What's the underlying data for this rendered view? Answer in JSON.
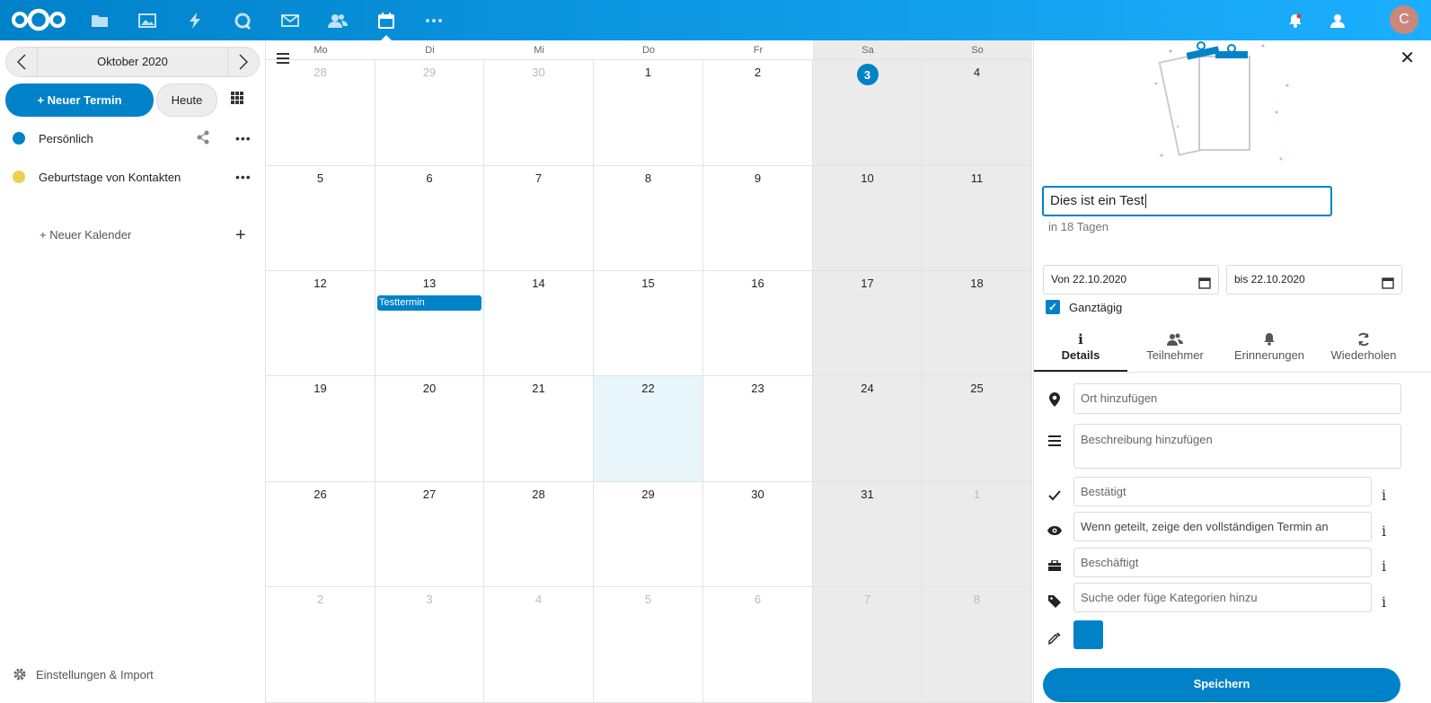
{
  "topbar": {
    "apps": [
      {
        "name": "files-icon"
      },
      {
        "name": "photos-icon"
      },
      {
        "name": "activity-icon"
      },
      {
        "name": "talk-icon"
      },
      {
        "name": "mail-icon"
      },
      {
        "name": "contacts-icon"
      },
      {
        "name": "calendar-icon"
      },
      {
        "name": "more-apps-icon"
      }
    ],
    "avatar_initial": "C",
    "brand_color": "#0082c9"
  },
  "sidebar": {
    "month_label": "Oktober 2020",
    "new_event_label": "+ Neuer Termin",
    "today_label": "Heute",
    "calendars": [
      {
        "name": "Persönlich",
        "color": "#0082c9"
      },
      {
        "name": "Geburtstage von Kontakten",
        "color": "#e9d04f"
      }
    ],
    "new_calendar_label": "+ Neuer Kalender",
    "settings_label": "Einstellungen & Import"
  },
  "calendar": {
    "weekdays": [
      "Mo",
      "Di",
      "Mi",
      "Do",
      "Fr",
      "Sa",
      "So"
    ],
    "weeks": [
      [
        {
          "d": "28",
          "other": true
        },
        {
          "d": "29",
          "other": true
        },
        {
          "d": "30",
          "other": true
        },
        {
          "d": "1"
        },
        {
          "d": "2"
        },
        {
          "d": "3",
          "today": true
        },
        {
          "d": "4"
        }
      ],
      [
        {
          "d": "5"
        },
        {
          "d": "6"
        },
        {
          "d": "7"
        },
        {
          "d": "8"
        },
        {
          "d": "9"
        },
        {
          "d": "10"
        },
        {
          "d": "11"
        }
      ],
      [
        {
          "d": "12"
        },
        {
          "d": "13"
        },
        {
          "d": "14"
        },
        {
          "d": "15"
        },
        {
          "d": "16"
        },
        {
          "d": "17"
        },
        {
          "d": "18"
        }
      ],
      [
        {
          "d": "19"
        },
        {
          "d": "20"
        },
        {
          "d": "21"
        },
        {
          "d": "22",
          "selected": true
        },
        {
          "d": "23"
        },
        {
          "d": "24"
        },
        {
          "d": "25"
        }
      ],
      [
        {
          "d": "26"
        },
        {
          "d": "27"
        },
        {
          "d": "28"
        },
        {
          "d": "29"
        },
        {
          "d": "30"
        },
        {
          "d": "31"
        },
        {
          "d": "1",
          "other": true
        }
      ],
      [
        {
          "d": "2",
          "other": true
        },
        {
          "d": "3",
          "other": true
        },
        {
          "d": "4",
          "other": true
        },
        {
          "d": "5",
          "other": true
        },
        {
          "d": "6",
          "other": true
        },
        {
          "d": "7",
          "other": true
        },
        {
          "d": "8",
          "other": true
        }
      ]
    ],
    "events": [
      {
        "title": "Testtermin",
        "date": "13"
      }
    ]
  },
  "panel": {
    "title_value": "Dies ist ein Test",
    "relative_time": "in 18 Tagen",
    "from_date": "Von 22.10.2020",
    "to_date": "bis 22.10.2020",
    "allday_label": "Ganztägig",
    "allday_checked": true,
    "tabs": [
      "Details",
      "Teilnehmer",
      "Erinnerungen",
      "Wiederholen"
    ],
    "location_placeholder": "Ort hinzufügen",
    "description_placeholder": "Beschreibung hinzufügen",
    "status_value": "Bestätigt",
    "visibility_value": "Wenn geteilt, zeige den vollständigen Termin an",
    "busy_value": "Beschäftigt",
    "categories_placeholder": "Suche oder füge Kategorien hinzu",
    "event_color": "#0082c9",
    "save_label": "Speichern"
  }
}
